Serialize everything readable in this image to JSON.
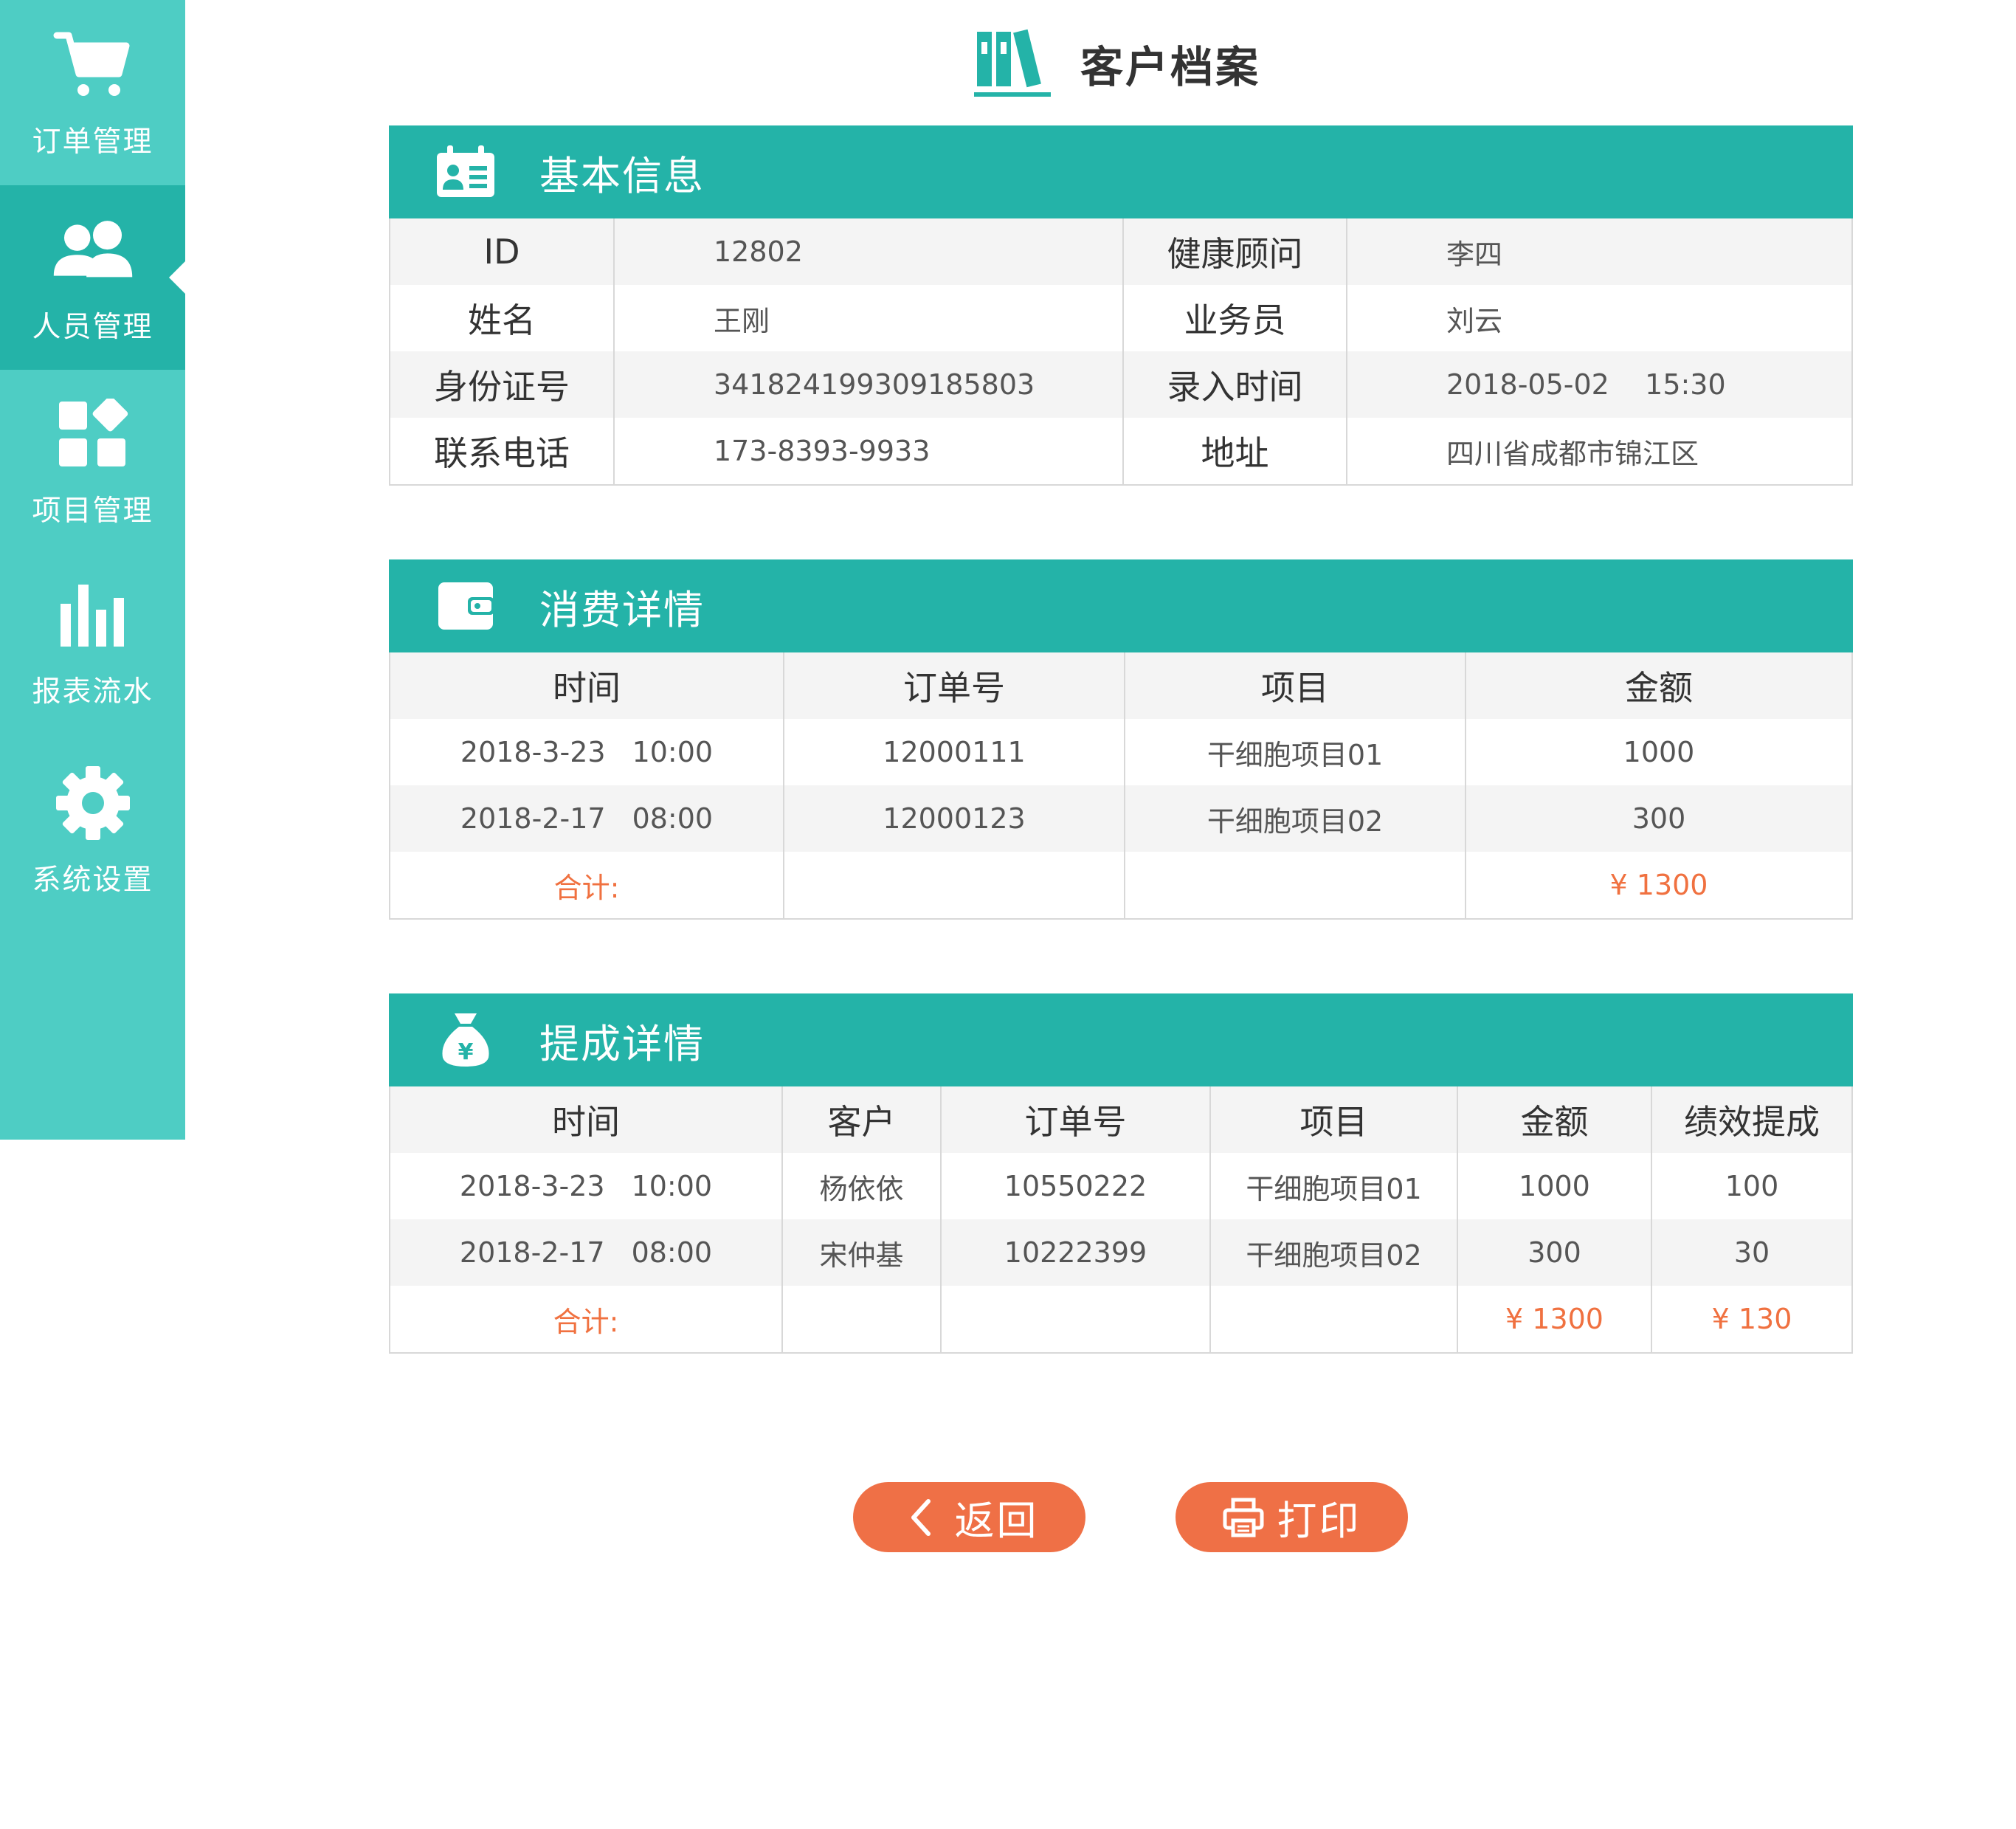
{
  "sidebar": {
    "items": [
      {
        "label": "订单管理",
        "icon": "cart-icon"
      },
      {
        "label": "人员管理",
        "icon": "users-icon",
        "active": true
      },
      {
        "label": "项目管理",
        "icon": "apps-icon"
      },
      {
        "label": "报表流水",
        "icon": "bar-chart-icon"
      },
      {
        "label": "系统设置",
        "icon": "gear-icon"
      }
    ]
  },
  "page": {
    "title": "客户档案",
    "title_icon": "binders-icon"
  },
  "basic_info": {
    "title": "基本信息",
    "icon": "id-card-icon",
    "rows": [
      {
        "label1": "ID",
        "value1": "12802",
        "label2": "健康顾问",
        "value2": "李四"
      },
      {
        "label1": "姓名",
        "value1": "王刚",
        "label2": "业务员",
        "value2": "刘云"
      },
      {
        "label1": "身份证号",
        "value1": "341824199309185803",
        "label2": "录入时间",
        "value2": "2018-05-02    15:30"
      },
      {
        "label1": "联系电话",
        "value1": "173-8393-9933",
        "label2": "地址",
        "value2": "四川省成都市锦江区"
      }
    ]
  },
  "consumption": {
    "title": "消费详情",
    "icon": "wallet-icon",
    "headers": [
      "时间",
      "订单号",
      "项目",
      "金额"
    ],
    "rows": [
      {
        "date": "2018-3-23",
        "time": "10:00",
        "order": "12000111",
        "project": "干细胞项目01",
        "amount": "1000"
      },
      {
        "date": "2018-2-17",
        "time": "08:00",
        "order": "12000123",
        "project": "干细胞项目02",
        "amount": "300"
      }
    ],
    "total_label": "合计:",
    "total_amount": "¥ 1300"
  },
  "commission": {
    "title": "提成详情",
    "icon": "money-bag-icon",
    "headers": [
      "时间",
      "客户",
      "订单号",
      "项目",
      "金额",
      "绩效提成"
    ],
    "rows": [
      {
        "date": "2018-3-23",
        "time": "10:00",
        "customer": "杨依依",
        "order": "10550222",
        "project": "干细胞项目01",
        "amount": "1000",
        "commission": "100"
      },
      {
        "date": "2018-2-17",
        "time": "08:00",
        "customer": "宋仲基",
        "order": "10222399",
        "project": "干细胞项目02",
        "amount": "300",
        "commission": "30"
      }
    ],
    "total_label": "合计:",
    "total_amount": "¥ 1300",
    "total_commission": "¥ 130"
  },
  "buttons": {
    "back_label": "返回",
    "back_icon": "chevron-left-icon",
    "print_label": "打印",
    "print_icon": "printer-icon"
  },
  "colors": {
    "sidebar": "#4ecdc4",
    "sidebar_active": "#24b3a8",
    "header": "#24b3a8",
    "accent": "#ef7046",
    "total_text": "#f07140"
  }
}
